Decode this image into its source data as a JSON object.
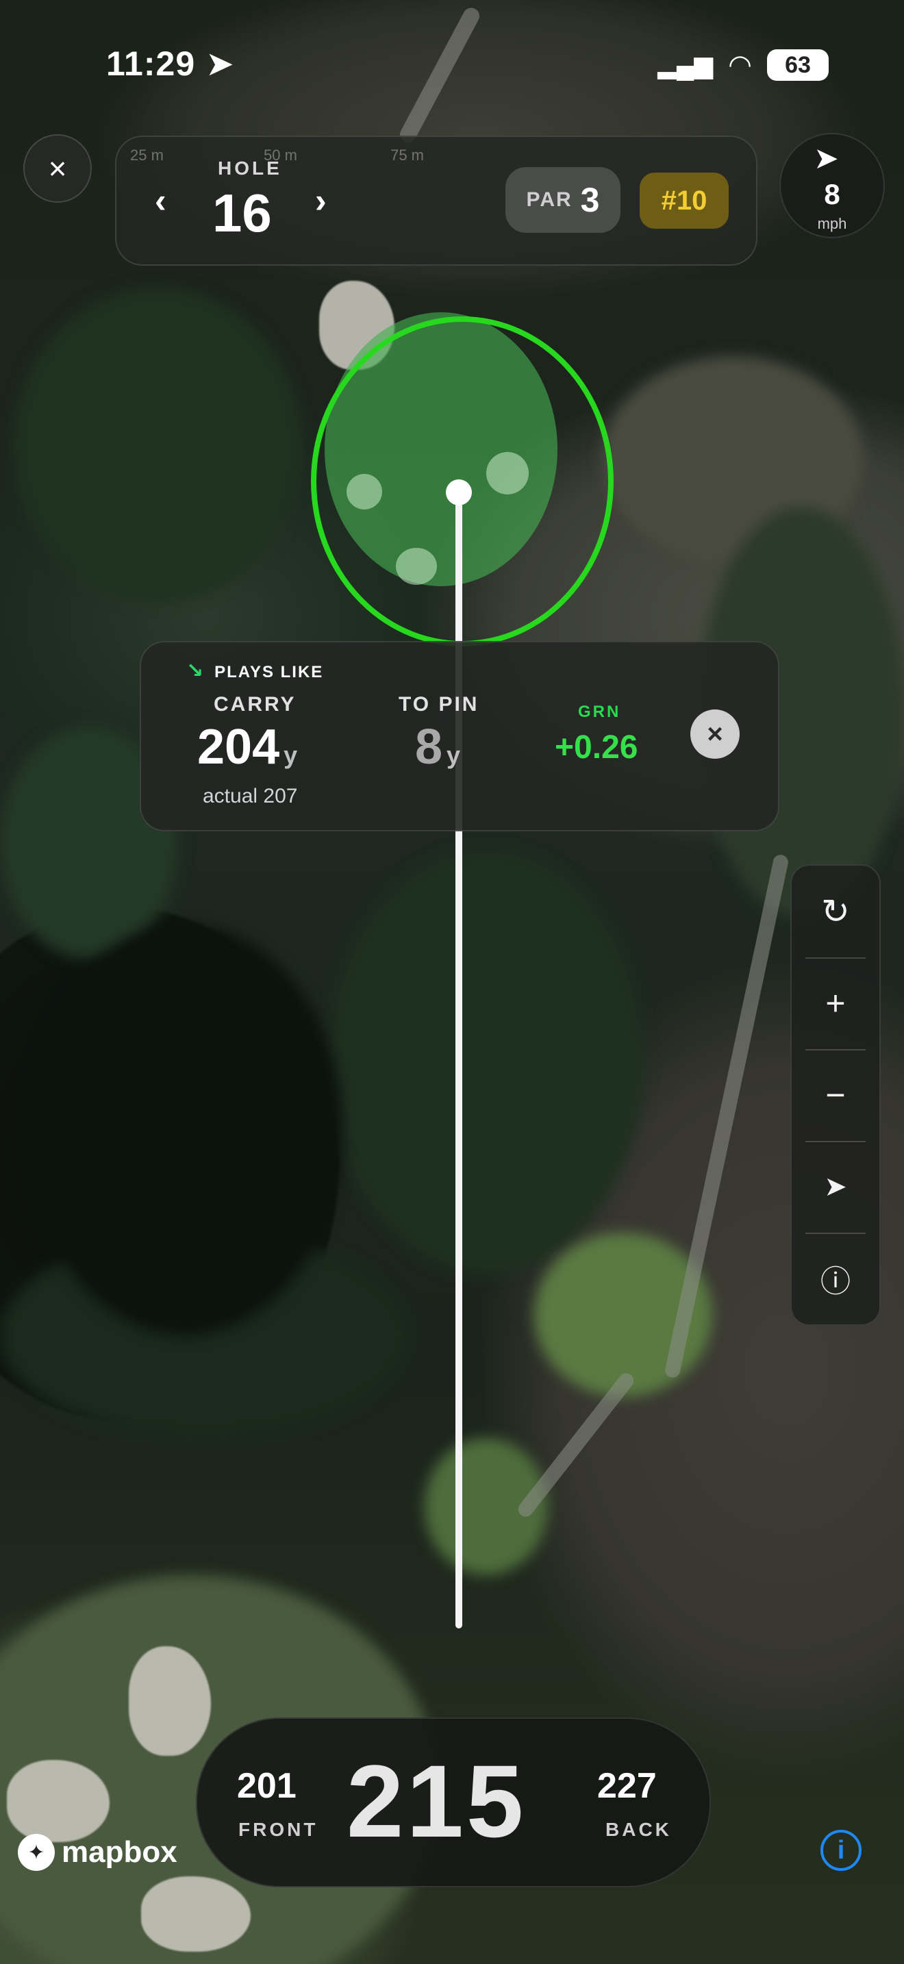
{
  "status_bar": {
    "time": "11:29",
    "battery": "63"
  },
  "header": {
    "close_icon": "×",
    "hole_label": "HOLE",
    "hole_number": "16",
    "prev_icon": "‹",
    "next_icon": "›",
    "par_label": "PAR",
    "par_value": "3",
    "handicap_rank": "#10",
    "scale_marks": [
      "25 m",
      "50 m",
      "75 m"
    ]
  },
  "wind": {
    "speed": "8",
    "unit": "mph",
    "direction_icon": "navigation-arrow-icon"
  },
  "shot_card": {
    "plays_like": "PLAYS LIKE",
    "carry_label": "CARRY",
    "carry_value": "204",
    "carry_unit": "y",
    "actual_text": "actual 207",
    "to_pin_label": "TO PIN",
    "to_pin_value": "8",
    "to_pin_unit": "y",
    "grn_label": "GRN",
    "grn_value": "+0.26",
    "close_icon": "×"
  },
  "toolbar": {
    "items": [
      {
        "icon": "reset-icon",
        "glyph": "↻"
      },
      {
        "icon": "zoom-in-icon",
        "glyph": "+"
      },
      {
        "icon": "zoom-out-icon",
        "glyph": "−"
      },
      {
        "icon": "locate-icon",
        "glyph": "➤"
      },
      {
        "icon": "info-icon",
        "glyph": "ⓘ"
      }
    ]
  },
  "distances": {
    "front_value": "201",
    "front_label": "FRONT",
    "center_value": "215",
    "back_value": "227",
    "back_label": "BACK"
  },
  "map": {
    "attribution": "mapbox",
    "info_glyph": "i"
  },
  "colors": {
    "green_outline": "#27d81f",
    "grn_value": "#34e14b",
    "handicap_text": "#f2cd34",
    "attribution": "#1e88f5"
  }
}
